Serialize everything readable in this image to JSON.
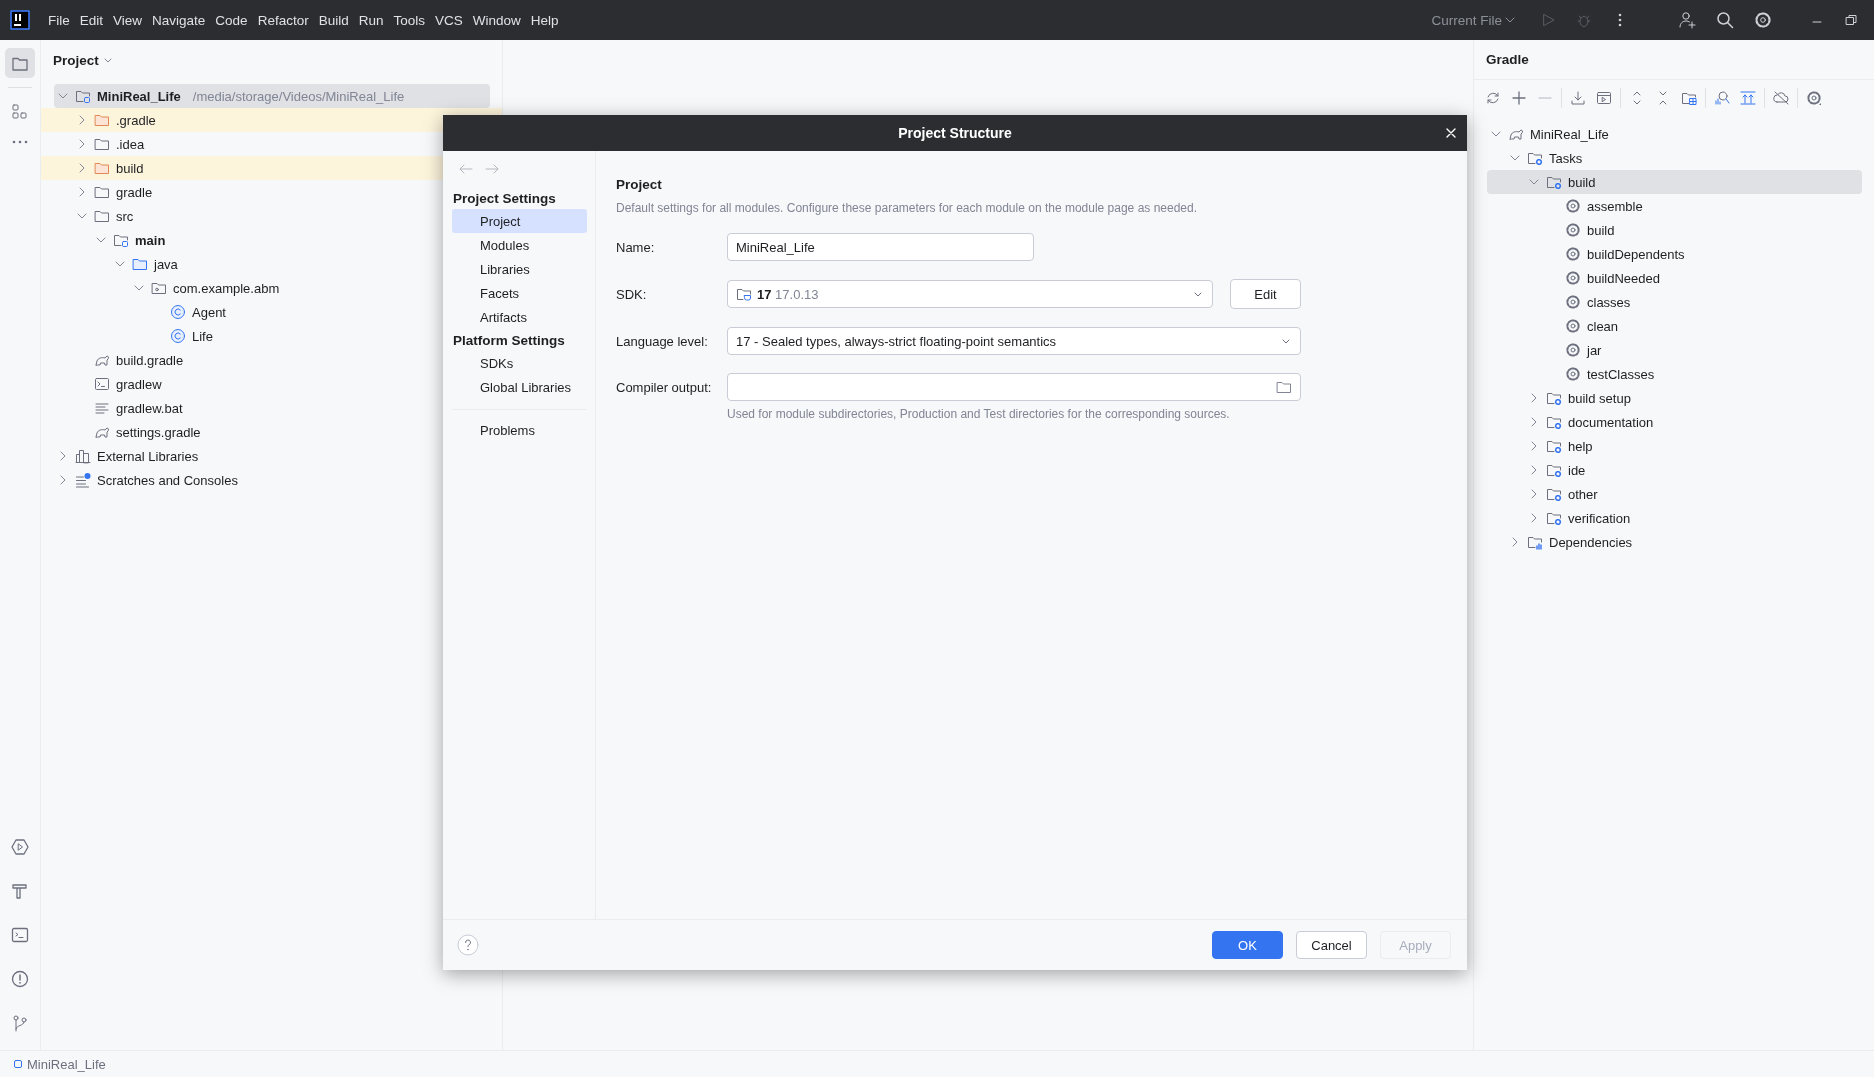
{
  "menu_bar": {
    "items": [
      "File",
      "Edit",
      "View",
      "Navigate",
      "Code",
      "Refactor",
      "Build",
      "Run",
      "Tools",
      "VCS",
      "Window",
      "Help"
    ],
    "run_configuration": "Current File"
  },
  "project_panel": {
    "title": "Project",
    "tree": [
      {
        "label": "MiniReal_Life",
        "path": "/media/storage/Videos/MiniReal_Life",
        "kind": "module",
        "expanded": true,
        "selected": true,
        "children": [
          {
            "label": ".gradle",
            "kind": "excluded-folder",
            "expanded": false,
            "selected": false
          },
          {
            "label": ".idea",
            "kind": "folder",
            "expanded": false,
            "selected": false
          },
          {
            "label": "build",
            "kind": "excluded-folder",
            "expanded": false,
            "selected": false
          },
          {
            "label": "gradle",
            "kind": "folder",
            "expanded": false,
            "selected": false
          },
          {
            "label": "src",
            "kind": "folder",
            "expanded": true,
            "selected": false,
            "children": [
              {
                "label": "main",
                "kind": "source-set",
                "expanded": true,
                "selected": false,
                "children": [
                  {
                    "label": "java",
                    "kind": "source-root",
                    "expanded": true,
                    "selected": false,
                    "children": [
                      {
                        "label": "com.example.abm",
                        "kind": "package",
                        "expanded": true,
                        "selected": false,
                        "children": [
                          {
                            "label": "Agent",
                            "kind": "class",
                            "selected": false
                          },
                          {
                            "label": "Life",
                            "kind": "class",
                            "selected": false
                          }
                        ]
                      }
                    ]
                  }
                ]
              }
            ]
          },
          {
            "label": "build.gradle",
            "kind": "gradle-file",
            "selected": false
          },
          {
            "label": "gradlew",
            "kind": "script",
            "selected": false
          },
          {
            "label": "gradlew.bat",
            "kind": "text-file",
            "selected": false
          },
          {
            "label": "settings.gradle",
            "kind": "gradle-file",
            "selected": false
          }
        ]
      },
      {
        "label": "External Libraries",
        "kind": "libraries",
        "expanded": false,
        "selected": false
      },
      {
        "label": "Scratches and Consoles",
        "kind": "scratches",
        "expanded": false,
        "selected": false
      }
    ]
  },
  "gradle_panel": {
    "title": "Gradle",
    "tree": [
      {
        "label": "MiniReal_Life",
        "kind": "gradle-project",
        "expanded": true,
        "selected": false,
        "children": [
          {
            "label": "Tasks",
            "kind": "task-group",
            "expanded": true,
            "selected": false,
            "children": [
              {
                "label": "build",
                "kind": "task-group",
                "expanded": true,
                "selected": true,
                "children": [
                  {
                    "label": "assemble",
                    "kind": "task",
                    "selected": false
                  },
                  {
                    "label": "build",
                    "kind": "task",
                    "selected": false
                  },
                  {
                    "label": "buildDependents",
                    "kind": "task",
                    "selected": false
                  },
                  {
                    "label": "buildNeeded",
                    "kind": "task",
                    "selected": false
                  },
                  {
                    "label": "classes",
                    "kind": "task",
                    "selected": false
                  },
                  {
                    "label": "clean",
                    "kind": "task",
                    "selected": false
                  },
                  {
                    "label": "jar",
                    "kind": "task",
                    "selected": false
                  },
                  {
                    "label": "testClasses",
                    "kind": "task",
                    "selected": false
                  }
                ]
              },
              {
                "label": "build setup",
                "kind": "task-group",
                "expanded": false,
                "selected": false
              },
              {
                "label": "documentation",
                "kind": "task-group",
                "expanded": false,
                "selected": false
              },
              {
                "label": "help",
                "kind": "task-group",
                "expanded": false,
                "selected": false
              },
              {
                "label": "ide",
                "kind": "task-group",
                "expanded": false,
                "selected": false
              },
              {
                "label": "other",
                "kind": "task-group",
                "expanded": false,
                "selected": false
              },
              {
                "label": "verification",
                "kind": "task-group",
                "expanded": false,
                "selected": false
              }
            ]
          },
          {
            "label": "Dependencies",
            "kind": "dependencies",
            "expanded": false,
            "selected": false
          }
        ]
      }
    ]
  },
  "dialog": {
    "title": "Project Structure",
    "nav": [
      {
        "title": "Project Settings",
        "items": [
          {
            "label": "Project",
            "selected": true
          },
          {
            "label": "Modules",
            "selected": false
          },
          {
            "label": "Libraries",
            "selected": false
          },
          {
            "label": "Facets",
            "selected": false
          },
          {
            "label": "Artifacts",
            "selected": false
          }
        ]
      },
      {
        "title": "Platform Settings",
        "items": [
          {
            "label": "SDKs",
            "selected": false
          },
          {
            "label": "Global Libraries",
            "selected": false
          }
        ]
      },
      {
        "items": [
          {
            "label": "Problems",
            "selected": false
          }
        ]
      }
    ],
    "heading": "Project",
    "description": "Default settings for all modules. Configure these parameters for each module on the module page as needed.",
    "fields": [
      {
        "kind": "text",
        "label": "Name:",
        "value": "MiniReal_Life"
      },
      {
        "kind": "sdk",
        "label": "SDK:",
        "version": "17",
        "detail": "17.0.13",
        "button": "Edit"
      },
      {
        "kind": "combo",
        "label": "Language level:",
        "value": "17 - Sealed types, always-strict floating-point semantics"
      },
      {
        "kind": "path",
        "label": "Compiler output:",
        "note": "Used for module subdirectories, Production and Test directories for the corresponding sources."
      }
    ],
    "buttons": [
      {
        "label": "OK",
        "kind": "primary",
        "disabled": false
      },
      {
        "label": "Cancel",
        "kind": "secondary",
        "disabled": false
      },
      {
        "label": "Apply",
        "kind": "secondary",
        "disabled": true
      }
    ]
  },
  "status_bar": {
    "breadcrumb": "MiniReal_Life"
  }
}
